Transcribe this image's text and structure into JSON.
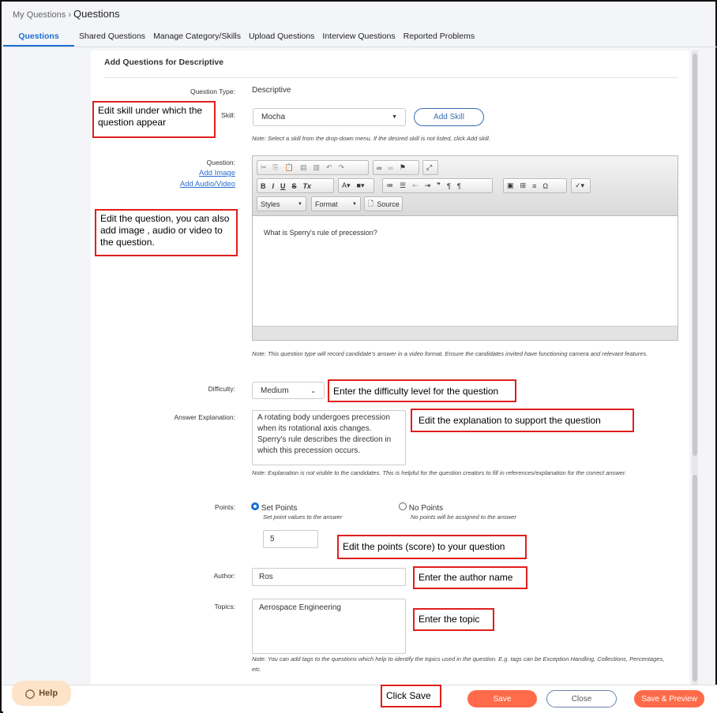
{
  "breadcrumb": {
    "parent": "My Questions",
    "separator": "›",
    "current": "Questions"
  },
  "tabs": [
    "Questions",
    "Shared Questions",
    "Manage Category/Skills",
    "Upload Questions",
    "Interview Questions",
    "Reported Problems"
  ],
  "form": {
    "title": "Add Questions for Descriptive",
    "question_type_label": "Question Type:",
    "question_type": "Descriptive",
    "skill_label": "Skill:",
    "skill_value": "Mocha",
    "add_skill": "Add Skill",
    "skill_note": "Note: Select a skill from the drop-down menu. If the desired skill is not listed, click Add skill.",
    "question_label": "Question:",
    "add_image": "Add Image",
    "add_av": "Add Audio/Video",
    "editor": {
      "styles": "Styles",
      "format": "Format",
      "source": "Source",
      "content": "What is Sperry's rule of precession?"
    },
    "question_note": "Note: This question type will record candidate's answer in a video format. Ensure the candidates invited have functioning camera and relevant features.",
    "difficulty_label": "Difficulty:",
    "difficulty": "Medium",
    "explanation_label": "Answer Explanation:",
    "explanation": "A rotating body undergoes precession when its rotational axis changes. Sperry's rule describes the direction in which this precession occurs.",
    "explanation_note": "Note: Explanation is not visible to the candidates. This is helpful for the question creators to fill in references/explanation for the correct answer.",
    "points_label": "Points:",
    "set_points": "Set Points",
    "set_points_sub": "Set point values to the answer",
    "no_points": "No Points",
    "no_points_sub": "No points will be assigned to the answer",
    "points_value": "5",
    "points_mode": "set",
    "author_label": "Author:",
    "author": "Ros",
    "topics_label": "Topics:",
    "topics": "Aerospace Engineering",
    "topics_note": "Note: You can add tags to the questions which help to identify the topics used in the question. E.g. tags can be Exception Handling, Collections, Percentages, etc."
  },
  "annotations": {
    "skill": "Edit skill under which the question appear",
    "question": "Edit the question, you can also add image , audio or video to the question.",
    "difficulty": "Enter the difficulty level for the question",
    "explanation": "Edit the explanation to support the question",
    "points": "Edit the points (score) to your question",
    "author": "Enter the author name",
    "topic": "Enter the topic",
    "save": "Click Save"
  },
  "footer": {
    "help": "Help",
    "save": "Save",
    "close": "Close",
    "save_preview": "Save & Preview"
  },
  "colors": {
    "accent": "#1a6fd6",
    "primary_button": "#ff6b4a",
    "annotation_border": "#e01e1e"
  }
}
